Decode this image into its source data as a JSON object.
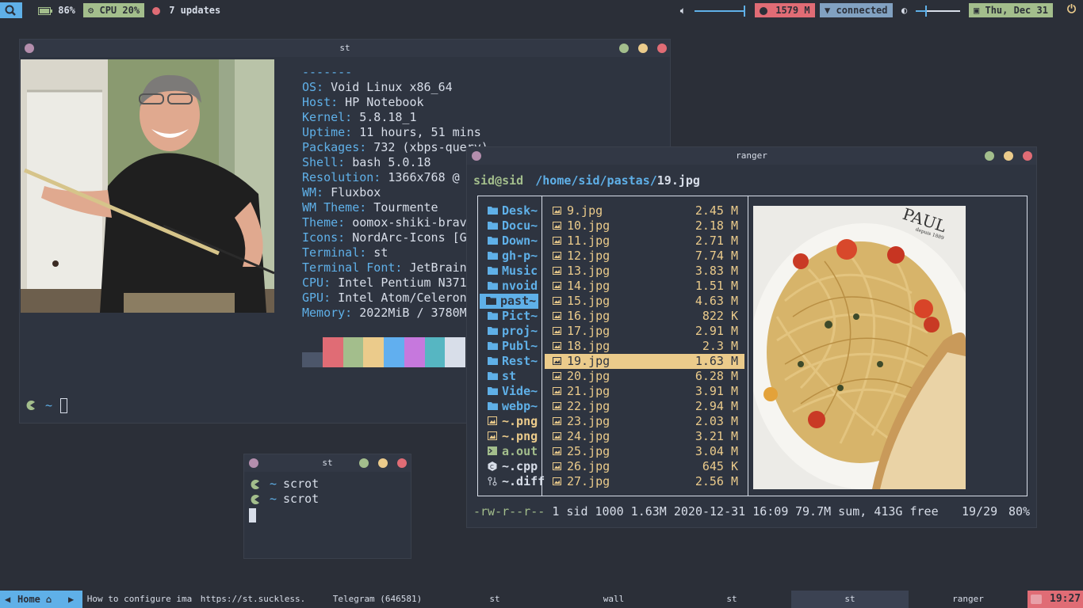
{
  "topbar": {
    "battery": "86%",
    "cpu": "CPU 20%",
    "updates": "7 updates",
    "memory": "1579 M",
    "network": "connected",
    "date": "Thu, Dec 31"
  },
  "neofetch_window": {
    "title": "st",
    "separator": "-------",
    "info": [
      {
        "key": "OS:",
        "value": " Void Linux x86_64"
      },
      {
        "key": "Host:",
        "value": " HP Notebook"
      },
      {
        "key": "Kernel:",
        "value": " 5.8.18_1"
      },
      {
        "key": "Uptime:",
        "value": " 11 hours, 51 mins"
      },
      {
        "key": "Packages:",
        "value": " 732 (xbps-query)"
      },
      {
        "key": "Shell:",
        "value": " bash 5.0.18"
      },
      {
        "key": "Resolution:",
        "value": " 1366x768 @"
      },
      {
        "key": "WM:",
        "value": " Fluxbox"
      },
      {
        "key": "WM Theme:",
        "value": " Tourmente"
      },
      {
        "key": "Theme:",
        "value": " oomox-shiki-brav"
      },
      {
        "key": "Icons:",
        "value": " NordArc-Icons [G"
      },
      {
        "key": "Terminal:",
        "value": " st"
      },
      {
        "key": "Terminal Font:",
        "value": " JetBrain"
      },
      {
        "key": "CPU:",
        "value": " Intel Pentium N371"
      },
      {
        "key": "GPU:",
        "value": " Intel Atom/Celeron"
      },
      {
        "key": "Memory:",
        "value": " 2022MiB / 3780M"
      }
    ],
    "palette": [
      "#4c566a",
      "#e06c75",
      "#a3be8c",
      "#ebcb8b",
      "#61afef",
      "#c678dd",
      "#56b6c2",
      "#d8dee9"
    ],
    "prompt": "~"
  },
  "small_term": {
    "title": "st",
    "lines": [
      {
        "prompt": "~",
        "cmd": "scrot"
      },
      {
        "prompt": "~",
        "cmd": "scrot"
      }
    ]
  },
  "ranger": {
    "title": "ranger",
    "user": "sid@sid",
    "path": "/home/sid/pastas/",
    "file": "19.jpg",
    "dirs": [
      {
        "icon": "folder",
        "name": "Desk~"
      },
      {
        "icon": "folder",
        "name": "Docu~"
      },
      {
        "icon": "folder",
        "name": "Down~"
      },
      {
        "icon": "folder",
        "name": "gh-p~"
      },
      {
        "icon": "folder",
        "name": "Music"
      },
      {
        "icon": "folder",
        "name": "nvoid"
      },
      {
        "icon": "folder",
        "name": "past~",
        "selected": true
      },
      {
        "icon": "folder",
        "name": "Pict~"
      },
      {
        "icon": "folder",
        "name": "proj~"
      },
      {
        "icon": "folder",
        "name": "Publ~"
      },
      {
        "icon": "folder",
        "name": "Rest~"
      },
      {
        "icon": "folder",
        "name": "st"
      },
      {
        "icon": "folder",
        "name": "Vide~"
      },
      {
        "icon": "folder",
        "name": "webp~"
      },
      {
        "icon": "image",
        "name": "~.png"
      },
      {
        "icon": "image",
        "name": "~.png"
      },
      {
        "icon": "exec",
        "name": "a.out"
      },
      {
        "icon": "cpp",
        "name": "~.cpp"
      },
      {
        "icon": "diff",
        "name": "~.diff"
      }
    ],
    "files": [
      {
        "name": "9.jpg",
        "size": "2.45 M"
      },
      {
        "name": "10.jpg",
        "size": "2.18 M"
      },
      {
        "name": "11.jpg",
        "size": "2.71 M"
      },
      {
        "name": "12.jpg",
        "size": "7.74 M"
      },
      {
        "name": "13.jpg",
        "size": "3.83 M"
      },
      {
        "name": "14.jpg",
        "size": "1.51 M"
      },
      {
        "name": "15.jpg",
        "size": "4.63 M"
      },
      {
        "name": "16.jpg",
        "size": "822 K"
      },
      {
        "name": "17.jpg",
        "size": "2.91 M"
      },
      {
        "name": "18.jpg",
        "size": "2.3 M"
      },
      {
        "name": "19.jpg",
        "size": "1.63 M",
        "selected": true
      },
      {
        "name": "20.jpg",
        "size": "6.28 M"
      },
      {
        "name": "21.jpg",
        "size": "3.91 M"
      },
      {
        "name": "22.jpg",
        "size": "2.94 M"
      },
      {
        "name": "23.jpg",
        "size": "2.03 M"
      },
      {
        "name": "24.jpg",
        "size": "3.21 M"
      },
      {
        "name": "25.jpg",
        "size": "3.04 M"
      },
      {
        "name": "26.jpg",
        "size": "645 K"
      },
      {
        "name": "27.jpg",
        "size": "2.56 M"
      }
    ],
    "preview_logo": "PAUL",
    "preview_logo_sub": "depuis 1889",
    "status": {
      "perms": "-rw-r--r--",
      "info": " 1 sid 1000 1.63M 2020-12-31 16:09",
      "summary": "79.7M sum, 413G free",
      "position": "19/29",
      "percent": "80%"
    }
  },
  "taskbar": {
    "workspace": "Home",
    "tasks": [
      "How to configure ima",
      "https://st.suckless.",
      "Telegram (646581)",
      "st",
      "wall",
      "st",
      "st",
      "ranger"
    ],
    "clock": "19:27"
  }
}
